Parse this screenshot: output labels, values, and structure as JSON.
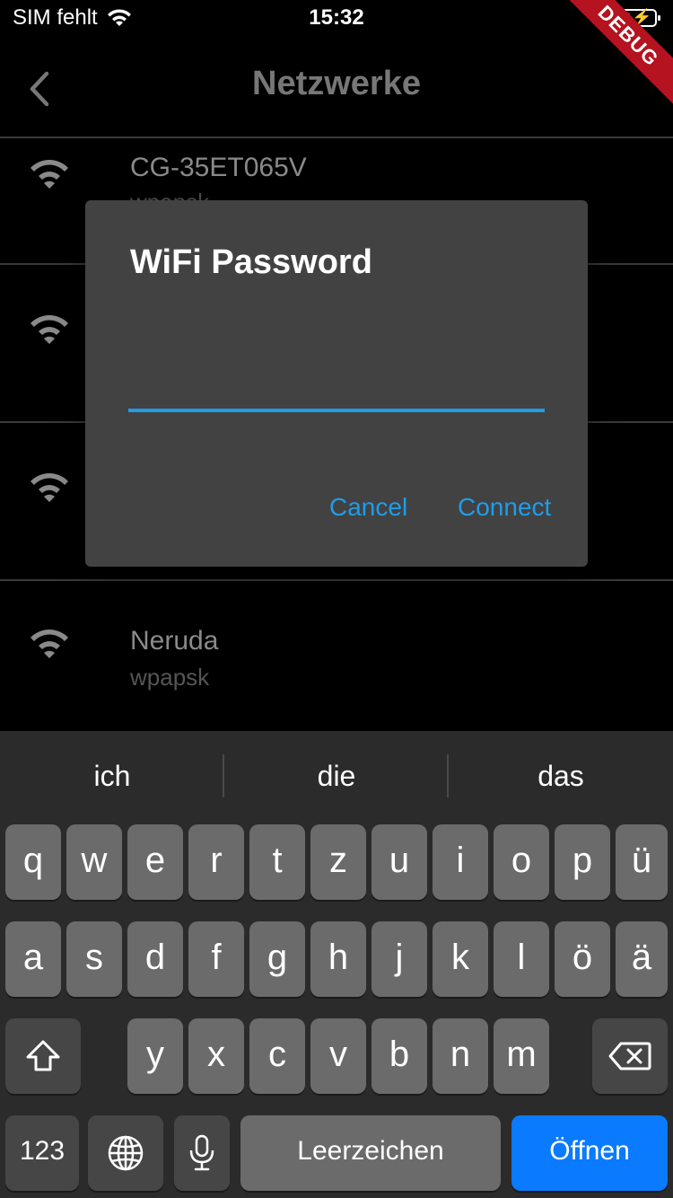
{
  "status_bar": {
    "carrier": "SIM fehlt",
    "time": "15:32",
    "debug_label": "DEBUG"
  },
  "app_bar": {
    "title": "Netzwerke"
  },
  "networks": [
    {
      "ssid": "CG-35ET065V",
      "security": "wpapsk"
    },
    {
      "ssid": "",
      "security": ""
    },
    {
      "ssid": "",
      "security": ""
    },
    {
      "ssid": "Neruda",
      "security": "wpapsk"
    }
  ],
  "dialog": {
    "title": "WiFi Password",
    "password_value": "",
    "cancel_label": "Cancel",
    "connect_label": "Connect",
    "accent_color": "#1e9de8"
  },
  "keyboard": {
    "suggestions": [
      "ich",
      "die",
      "das"
    ],
    "row1": [
      "q",
      "w",
      "e",
      "r",
      "t",
      "z",
      "u",
      "i",
      "o",
      "p",
      "ü"
    ],
    "row2": [
      "a",
      "s",
      "d",
      "f",
      "g",
      "h",
      "j",
      "k",
      "l",
      "ö",
      "ä"
    ],
    "row3": [
      "y",
      "x",
      "c",
      "v",
      "b",
      "n",
      "m"
    ],
    "numbers_label": "123",
    "space_label": "Leerzeichen",
    "return_label": "Öffnen",
    "return_color": "#0a7aff"
  }
}
